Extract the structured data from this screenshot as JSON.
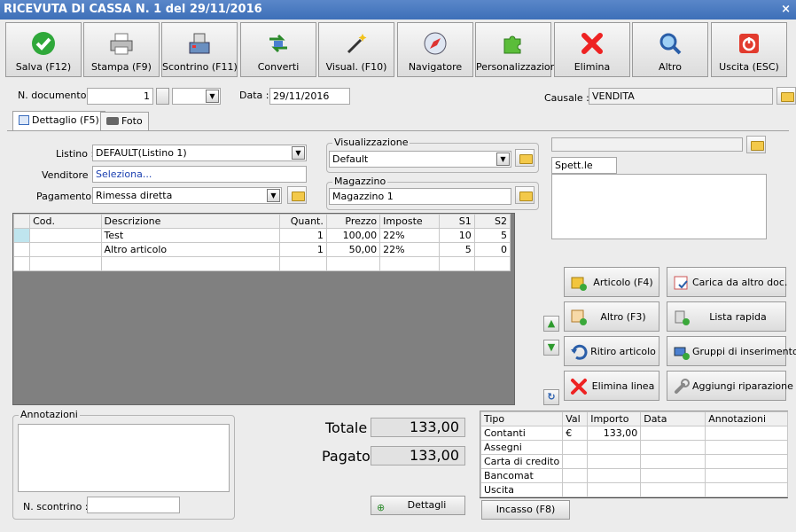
{
  "window": {
    "title": "RICEVUTA DI CASSA N. 1 del 29/11/2016",
    "close": "×"
  },
  "toolbar": [
    {
      "label": "Salva (F12)",
      "icon": "check-icon"
    },
    {
      "label": "Stampa (F9)",
      "icon": "printer-icon"
    },
    {
      "label": "Scontrino (F11)",
      "icon": "cash-register-icon"
    },
    {
      "label": "Converti",
      "icon": "convert-icon"
    },
    {
      "label": "Visual. (F10)",
      "icon": "magic-wand-icon"
    },
    {
      "label": "Navigatore",
      "icon": "compass-icon"
    },
    {
      "label": "Personalizzazioni",
      "icon": "puzzle-icon"
    },
    {
      "label": "Elimina",
      "icon": "delete-x-icon"
    },
    {
      "label": "Altro",
      "icon": "magnifier-icon"
    },
    {
      "label": "Uscita (ESC)",
      "icon": "power-icon"
    }
  ],
  "header": {
    "doc_label": "N. documento :",
    "doc_number": "1",
    "data_label": "Data :",
    "data_value": "29/11/2016",
    "causale_label": "Causale :",
    "causale_value": "VENDITA"
  },
  "tabs": {
    "dettaglio": "Dettaglio (F5)",
    "foto": "Foto"
  },
  "form": {
    "listino_label": "Listino :",
    "listino_value": "DEFAULT(Listino 1)",
    "venditore_label": "Venditore :",
    "venditore_value": "Seleziona...",
    "pagamento_label": "Pagamento :",
    "pagamento_value": "Rimessa diretta",
    "visualizzazione_title": "Visualizzazione",
    "visualizzazione_value": "Default",
    "magazzino_title": "Magazzino",
    "magazzino_value": "Magazzino 1",
    "cliente_value": "Spett.le"
  },
  "grid": {
    "headers": [
      "Cod.",
      "Descrizione",
      "Quant.",
      "Prezzo",
      "Imposte",
      "S1",
      "S2"
    ],
    "rows": [
      {
        "cod": "",
        "desc": "Test",
        "qty": "1",
        "price": "100,00",
        "tax": "22%",
        "s1": "10",
        "s2": "5"
      },
      {
        "cod": "",
        "desc": "Altro articolo",
        "qty": "1",
        "price": "50,00",
        "tax": "22%",
        "s1": "5",
        "s2": "0"
      }
    ]
  },
  "actions": {
    "articolo": "Articolo (F4)",
    "carica": "Carica da altro doc.",
    "altro": "Altro (F3)",
    "lista": "Lista rapida",
    "ritiro": "Ritiro articolo",
    "gruppi": "Gruppi di inserimento",
    "elimina_linea": "Elimina linea",
    "riparazione": "Aggiungi riparazione"
  },
  "notes": {
    "title": "Annotazioni",
    "scontrino_label": "N. scontrino :"
  },
  "totals": {
    "totale_label": "Totale",
    "totale_value": "133,00",
    "pagato_label": "Pagato",
    "pagato_value": "133,00",
    "dettagli": "Dettagli"
  },
  "payments": {
    "headers": [
      "Tipo",
      "Val",
      "Importo",
      "Data",
      "Annotazioni"
    ],
    "rows": [
      {
        "tipo": "Contanti",
        "val": "€",
        "importo": "133,00"
      },
      {
        "tipo": "Assegni",
        "val": "",
        "importo": ""
      },
      {
        "tipo": "Carta di credito",
        "val": "",
        "importo": ""
      },
      {
        "tipo": "Bancomat",
        "val": "",
        "importo": ""
      },
      {
        "tipo": "Uscita",
        "val": "",
        "importo": ""
      }
    ],
    "incasso": "Incasso (F8)"
  }
}
